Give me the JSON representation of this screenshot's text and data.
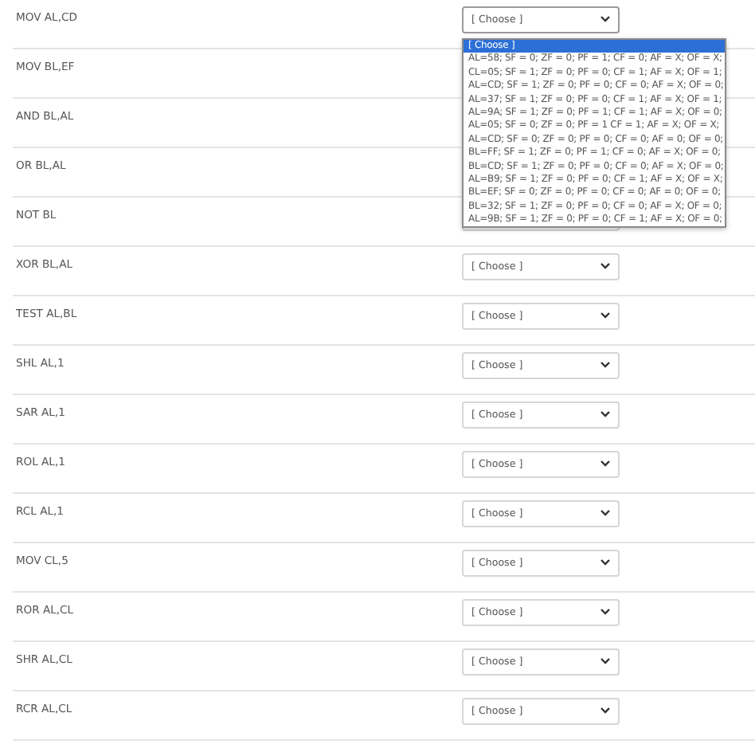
{
  "rows": [
    {
      "label": "MOV AL,CD",
      "select": {
        "value": "[ Choose ]",
        "open": true
      }
    },
    {
      "label": "MOV BL,EF"
    },
    {
      "label": "AND BL,AL"
    },
    {
      "label": "OR BL,AL"
    },
    {
      "label": "NOT BL",
      "select": {
        "open": false
      }
    },
    {
      "label": "XOR BL,AL",
      "select": {
        "value": "[ Choose ]",
        "open": false
      }
    },
    {
      "label": "TEST AL,BL",
      "select": {
        "value": "[ Choose ]",
        "open": false
      }
    },
    {
      "label": "SHL AL,1",
      "select": {
        "value": "[ Choose ]",
        "open": false
      }
    },
    {
      "label": "SAR AL,1",
      "select": {
        "value": "[ Choose ]",
        "open": false
      }
    },
    {
      "label": "ROL AL,1",
      "select": {
        "value": "[ Choose ]",
        "open": false
      }
    },
    {
      "label": "RCL AL,1",
      "select": {
        "value": "[ Choose ]",
        "open": false
      }
    },
    {
      "label": "MOV CL,5",
      "select": {
        "value": "[ Choose ]",
        "open": false
      }
    },
    {
      "label": "ROR AL,CL",
      "select": {
        "value": "[ Choose ]",
        "open": false
      }
    },
    {
      "label": "SHR AL,CL",
      "select": {
        "value": "[ Choose ]",
        "open": false
      }
    },
    {
      "label": "RCR AL,CL",
      "select": {
        "value": "[ Choose ]",
        "open": false
      }
    }
  ],
  "dropdown_options": [
    {
      "label": "[ Choose ]",
      "selected": true
    },
    {
      "label": "AL=58; SF = 0; ZF = 0; PF = 1; CF = 0; AF = X; OF = X;",
      "selected": false
    },
    {
      "label": "CL=05; SF = 1; ZF = 0; PF = 0; CF = 1; AF = X; OF = 1;",
      "selected": false
    },
    {
      "label": "AL=CD; SF = 1; ZF = 0; PF = 0; CF = 0; AF = X; OF = 0;",
      "selected": false
    },
    {
      "label": "AL=37; SF = 1; ZF = 0; PF = 0; CF = 1; AF = X; OF = 1;",
      "selected": false
    },
    {
      "label": "AL=9A; SF = 1; ZF = 0; PF = 1; CF = 1; AF = X; OF = 0;",
      "selected": false
    },
    {
      "label": "AL=05; SF = 0; ZF = 0; PF = 1 CF = 1; AF = X; OF = X;",
      "selected": false
    },
    {
      "label": "AL=CD; SF = 0; ZF = 0; PF = 0; CF = 0; AF = 0; OF = 0;",
      "selected": false
    },
    {
      "label": "BL=FF; SF = 1; ZF = 0; PF = 1; CF = 0; AF = X; OF = 0;",
      "selected": false
    },
    {
      "label": "BL=CD; SF = 1; ZF = 0; PF = 0; CF = 0; AF = X; OF = 0;",
      "selected": false
    },
    {
      "label": "AL=B9; SF = 1; ZF = 0; PF = 0; CF = 1; AF = X; OF = X;",
      "selected": false
    },
    {
      "label": "BL=EF; SF = 0; ZF = 0; PF = 0; CF = 0; AF = 0; OF = 0;",
      "selected": false
    },
    {
      "label": "BL=32; SF = 1; ZF = 0; PF = 0; CF = 0; AF = X; OF = 0;",
      "selected": false
    },
    {
      "label": "AL=9B; SF = 1; ZF = 0; PF = 0; CF = 1; AF = X; OF = 0;",
      "selected": false
    }
  ]
}
